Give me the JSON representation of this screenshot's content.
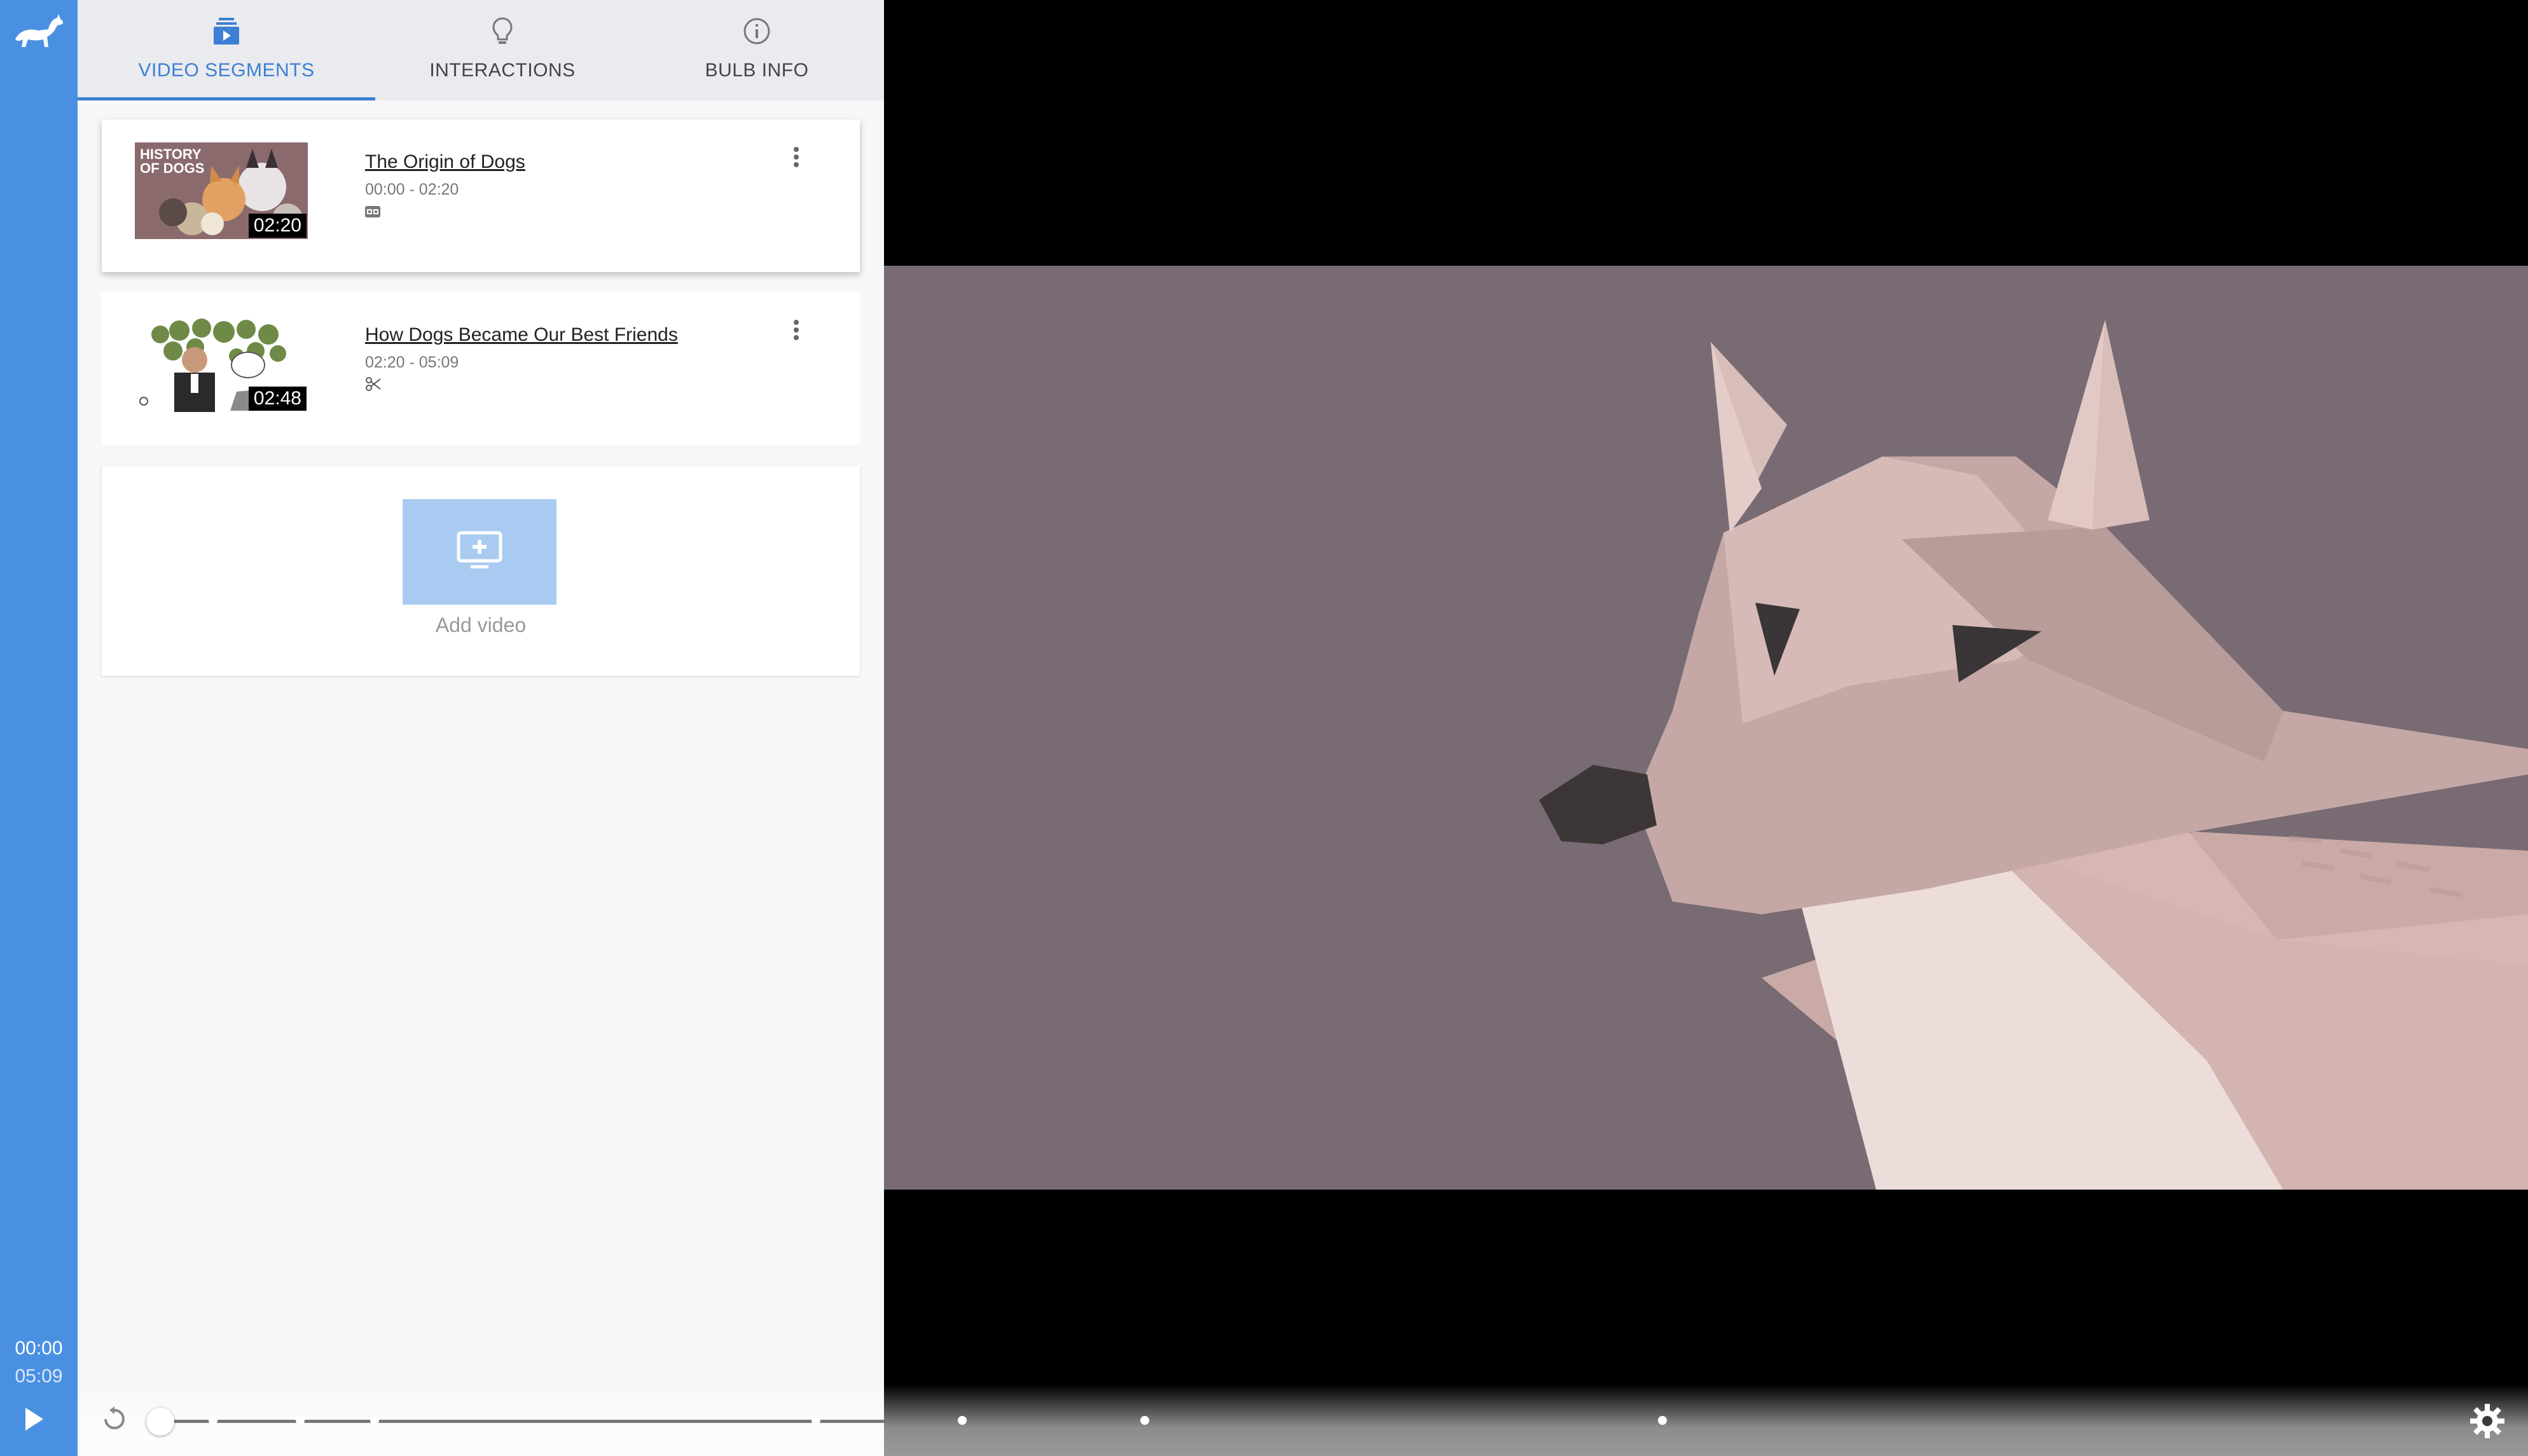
{
  "tabs": [
    {
      "label": "VIDEO SEGMENTS",
      "icon": "video-segments-icon",
      "active": true
    },
    {
      "label": "INTERACTIONS",
      "icon": "lightbulb-icon"
    },
    {
      "label": "BULB INFO",
      "icon": "info-icon"
    }
  ],
  "segments": [
    {
      "title": "The Origin of Dogs",
      "range": "00:00 - 02:20",
      "duration": "02:20",
      "flag_icon": "closed-captions-icon",
      "thumbnail_text": "HISTORY OF DOGS"
    },
    {
      "title": "How Dogs Became Our Best Friends",
      "range": "02:20 - 05:09",
      "duration": "02:48",
      "flag_icon": "scissors-icon"
    }
  ],
  "add_video": {
    "label": "Add video"
  },
  "player": {
    "current_time": "00:00",
    "total_time": "05:09",
    "progress": 0.0,
    "markers": [
      0.02,
      0.056,
      0.082,
      0.315,
      0.37,
      0.433,
      0.613
    ]
  },
  "colors": {
    "accent": "#4a90e2",
    "tab_active": "#3d7fd3",
    "add_button": "#a9cbf2",
    "video_bg": "#786b74"
  }
}
